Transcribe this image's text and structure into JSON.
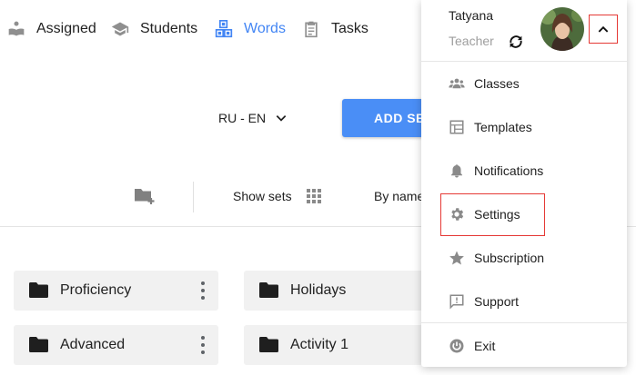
{
  "nav": {
    "items": [
      {
        "label": "Assigned",
        "icon": "reader-icon"
      },
      {
        "label": "Students",
        "icon": "graduation-cap-icon"
      },
      {
        "label": "Words",
        "icon": "abc-blocks-icon"
      },
      {
        "label": "Tasks",
        "icon": "clipboard-icon"
      }
    ],
    "active": "Words",
    "active_color": "#4285f4"
  },
  "controls": {
    "language_pair": "RU - EN",
    "add_set_label": "ADD SET",
    "show_sets_label": "Show sets",
    "sort_label": "By name"
  },
  "folders": [
    {
      "name": "Proficiency"
    },
    {
      "name": "Holidays"
    },
    {
      "name": "Advanced"
    },
    {
      "name": "Activity 1"
    }
  ],
  "user_menu": {
    "name": "Tatyana",
    "role": "Teacher",
    "items": [
      {
        "label": "Classes",
        "icon": "group-icon"
      },
      {
        "label": "Templates",
        "icon": "template-icon"
      },
      {
        "label": "Notifications",
        "icon": "bell-icon"
      },
      {
        "label": "Settings",
        "icon": "gear-icon"
      },
      {
        "label": "Subscription",
        "icon": "star-icon"
      },
      {
        "label": "Support",
        "icon": "feedback-icon"
      },
      {
        "label": "Exit",
        "icon": "power-icon"
      }
    ],
    "highlighted_item": "Settings",
    "highlight_color": "#e53935"
  },
  "colors": {
    "primary_button": "#4a8ef6",
    "folder_card": "#f1f1f1"
  }
}
